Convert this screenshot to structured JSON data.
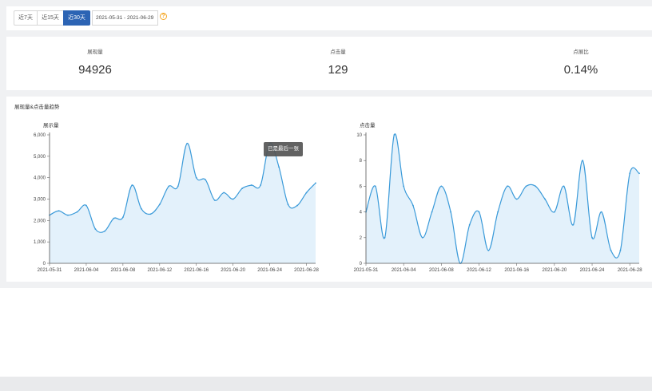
{
  "filters": {
    "ranges": [
      {
        "label": "近7天",
        "active": false
      },
      {
        "label": "近15天",
        "active": false
      },
      {
        "label": "近30天",
        "active": true
      }
    ],
    "date_range": "2021-05-31 - 2021-06-29",
    "help_icon": "question-circle-icon",
    "help_glyph": "?"
  },
  "kpis": [
    {
      "label": "展现量",
      "value": "94926"
    },
    {
      "label": "点击量",
      "value": "129"
    },
    {
      "label": "点展比",
      "value": "0.14%"
    }
  ],
  "trend": {
    "title": "展现量&点击量趋势",
    "tooltip": "已是最后一张"
  },
  "colors": {
    "accent": "#2c64b4",
    "line": "#3a9ad9",
    "area": "#e3f1fb"
  },
  "chart_data": [
    {
      "type": "area",
      "ylabel": "展示量",
      "ylim": [
        0,
        6000
      ],
      "yticks": [
        "0",
        "1,000",
        "2,000",
        "3,000",
        "4,000",
        "5,000",
        "6,000"
      ],
      "x_tick_labels": [
        "2021-05-31",
        "2021-06-04",
        "2021-06-08",
        "2021-06-12",
        "2021-06-16",
        "2021-06-20",
        "2021-06-24",
        "2021-06-28"
      ],
      "x": [
        "2021-05-31",
        "2021-06-01",
        "2021-06-02",
        "2021-06-03",
        "2021-06-04",
        "2021-06-05",
        "2021-06-06",
        "2021-06-07",
        "2021-06-08",
        "2021-06-09",
        "2021-06-10",
        "2021-06-11",
        "2021-06-12",
        "2021-06-13",
        "2021-06-14",
        "2021-06-15",
        "2021-06-16",
        "2021-06-17",
        "2021-06-18",
        "2021-06-19",
        "2021-06-20",
        "2021-06-21",
        "2021-06-22",
        "2021-06-23",
        "2021-06-24",
        "2021-06-25",
        "2021-06-26",
        "2021-06-27",
        "2021-06-28",
        "2021-06-29"
      ],
      "values": [
        2250,
        2450,
        2250,
        2400,
        2700,
        1600,
        1500,
        2100,
        2150,
        3650,
        2550,
        2300,
        2750,
        3600,
        3600,
        5600,
        4000,
        3900,
        2950,
        3300,
        3000,
        3500,
        3650,
        3650,
        5600,
        4500,
        2750,
        2700,
        3300,
        3750
      ]
    },
    {
      "type": "area",
      "ylabel": "点击量",
      "ylim": [
        0,
        10
      ],
      "yticks": [
        "0",
        "2",
        "4",
        "6",
        "8",
        "10"
      ],
      "x_tick_labels": [
        "2021-05-31",
        "2021-06-04",
        "2021-06-08",
        "2021-06-12",
        "2021-06-16",
        "2021-06-20",
        "2021-06-24",
        "2021-06-28"
      ],
      "x": [
        "2021-05-31",
        "2021-06-01",
        "2021-06-02",
        "2021-06-03",
        "2021-06-04",
        "2021-06-05",
        "2021-06-06",
        "2021-06-07",
        "2021-06-08",
        "2021-06-09",
        "2021-06-10",
        "2021-06-11",
        "2021-06-12",
        "2021-06-13",
        "2021-06-14",
        "2021-06-15",
        "2021-06-16",
        "2021-06-17",
        "2021-06-18",
        "2021-06-19",
        "2021-06-20",
        "2021-06-21",
        "2021-06-22",
        "2021-06-23",
        "2021-06-24",
        "2021-06-25",
        "2021-06-26",
        "2021-06-27",
        "2021-06-28",
        "2021-06-29"
      ],
      "values": [
        4,
        6,
        2,
        10,
        6,
        4.5,
        2,
        4,
        6,
        4,
        0,
        3,
        4,
        1,
        4,
        6,
        5,
        6,
        6,
        5,
        4,
        6,
        3,
        8,
        2,
        4,
        1,
        1,
        7,
        7
      ]
    }
  ]
}
